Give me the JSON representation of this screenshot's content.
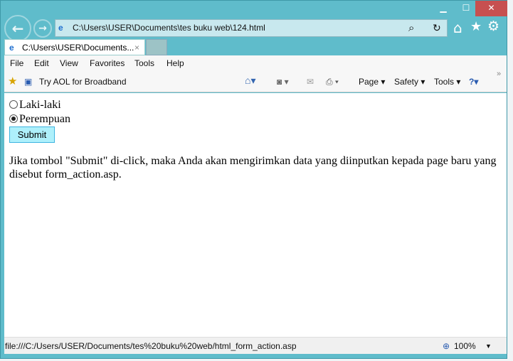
{
  "window": {
    "minimize": "▁",
    "maximize": "☐",
    "close": "✕"
  },
  "nav": {
    "back": "←",
    "forward": "→"
  },
  "address": {
    "value": "C:\\Users\\USER\\Documents\\tes buku web\\124.html",
    "search_icon": "⌕",
    "refresh_icon": "↻"
  },
  "tools": {
    "home": "⌂",
    "favorites": "★",
    "settings": "⚙"
  },
  "tab": {
    "title": "C:\\Users\\USER\\Documents...",
    "close": "×"
  },
  "menu": [
    "File",
    "Edit",
    "View",
    "Favorites",
    "Tools",
    "Help"
  ],
  "command_bar": {
    "aol_link": "Try AOL for Broadband",
    "page": "Page ▾",
    "safety": "Safety ▾",
    "tools": "Tools ▾",
    "help": "?▾",
    "more": "»"
  },
  "page": {
    "radios": [
      {
        "label": "Laki-laki",
        "checked": false
      },
      {
        "label": "Perempuan",
        "checked": true
      }
    ],
    "submit_label": "Submit",
    "paragraph": "Jika tombol \"Submit\" di-click, maka Anda akan mengirimkan data yang diinputkan kepada page baru yang disebut form_action.asp."
  },
  "status": {
    "url": "file:///C:/Users/USER/Documents/tes%20buku%20web/html_form_action.asp",
    "zoom": "100%"
  }
}
